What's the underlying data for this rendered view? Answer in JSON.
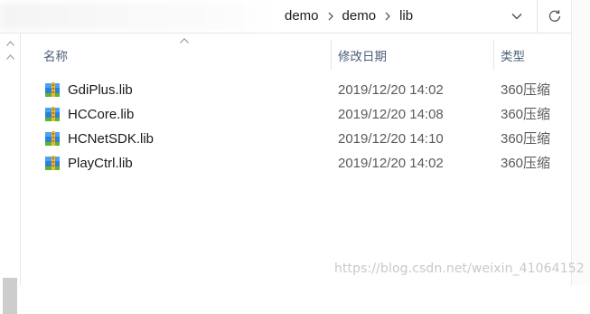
{
  "address_bar": {
    "breadcrumbs": [
      "demo",
      "demo",
      "lib"
    ]
  },
  "columns": {
    "name": "名称",
    "date_modified": "修改日期",
    "type": "类型"
  },
  "files": [
    {
      "name": "GdiPlus.lib",
      "date": "2019/12/20 14:02",
      "type": "360压缩"
    },
    {
      "name": "HCCore.lib",
      "date": "2019/12/20 14:08",
      "type": "360压缩"
    },
    {
      "name": "HCNetSDK.lib",
      "date": "2019/12/20 14:10",
      "type": "360压缩"
    },
    {
      "name": "PlayCtrl.lib",
      "date": "2019/12/20 14:02",
      "type": "360压缩"
    }
  ],
  "watermark": "https://blog.csdn.net/weixin_41064152",
  "icons": {
    "breadcrumb_separator": "chevron-right-icon",
    "address_dropdown": "chevron-down-icon",
    "refresh": "refresh-icon",
    "file": "archive-file-icon"
  },
  "colors": {
    "header_text": "#4c607a",
    "detail_text": "#5a5a5a",
    "watermark": "#c9c9c9"
  }
}
